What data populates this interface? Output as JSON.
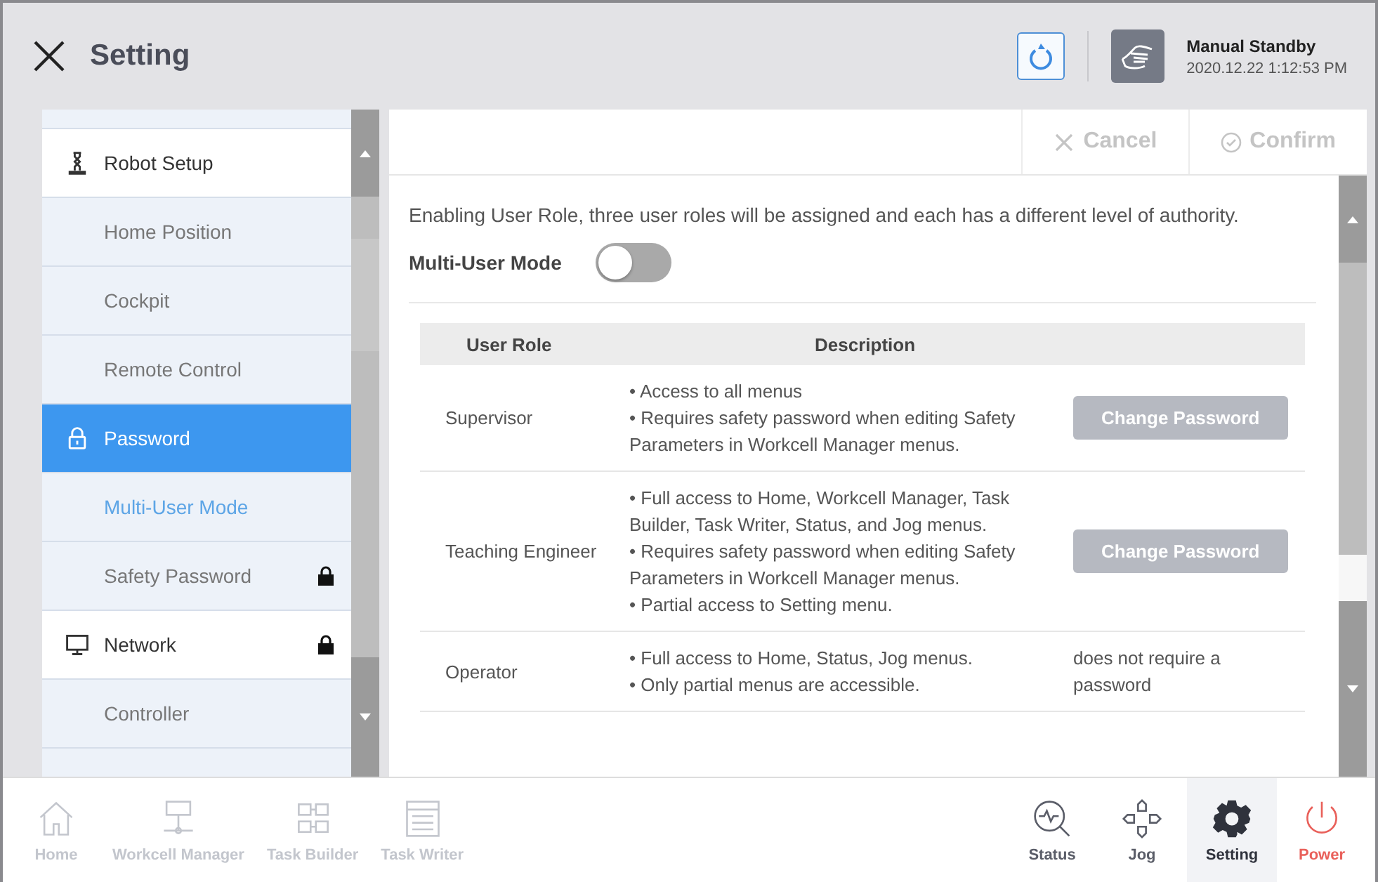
{
  "header": {
    "title": "Setting",
    "status": "Manual Standby",
    "datetime": "2020.12.22 1:12:53 PM"
  },
  "sidebar": {
    "items": [
      {
        "kind": "group",
        "label": "Robot Setup",
        "selected": false,
        "locked": false
      },
      {
        "kind": "item",
        "label": "Home Position",
        "selected": false,
        "locked": false
      },
      {
        "kind": "item",
        "label": "Cockpit",
        "selected": false,
        "locked": false
      },
      {
        "kind": "item",
        "label": "Remote Control",
        "selected": false,
        "locked": false
      },
      {
        "kind": "group",
        "label": "Password",
        "selected": true,
        "locked": false
      },
      {
        "kind": "item",
        "label": "Multi-User Mode",
        "selected": true,
        "locked": false
      },
      {
        "kind": "item",
        "label": "Safety Password",
        "selected": false,
        "locked": true
      },
      {
        "kind": "group",
        "label": "Network",
        "selected": false,
        "locked": true
      },
      {
        "kind": "item",
        "label": "Controller",
        "selected": false,
        "locked": false
      }
    ]
  },
  "actions": [
    {
      "kind": "cancel",
      "label": "Cancel",
      "disabled": true
    },
    {
      "kind": "confirm",
      "label": "Confirm",
      "disabled": true
    }
  ],
  "intro": "Enabling User Role, three user roles will be assigned and each has a different level of authority.",
  "multi_user_mode": {
    "label": "Multi-User Mode",
    "on": false
  },
  "table": {
    "columns": [
      "User Role",
      "Description"
    ],
    "rows": [
      {
        "role": "Supervisor",
        "description": [
          "• Access to all menus",
          "• Requires safety password when editing Safety Parameters in Workcell Manager menus."
        ],
        "action": {
          "kind": "button",
          "label": "Change Password",
          "disabled": true
        }
      },
      {
        "role": "Teaching Engineer",
        "description": [
          "• Full access to Home, Workcell Manager, Task Builder, Task Writer, Status, and Jog menus.",
          "• Requires safety password when editing Safety Parameters in Workcell Manager menus.",
          "• Partial access to Setting menu."
        ],
        "action": {
          "kind": "button",
          "label": "Change Password",
          "disabled": true
        }
      },
      {
        "role": "Operator",
        "description": [
          "• Full access to Home, Status, Jog menus.",
          "• Only partial menus are accessible."
        ],
        "action": {
          "kind": "note",
          "label": "does not require a password"
        }
      }
    ]
  },
  "nav": [
    {
      "kind": "home",
      "label": "Home",
      "disabled": true,
      "selected": false
    },
    {
      "kind": "workcell",
      "label": "Workcell Manager",
      "disabled": true,
      "selected": false
    },
    {
      "kind": "taskbuilder",
      "label": "Task Builder",
      "disabled": true,
      "selected": false
    },
    {
      "kind": "taskwriter",
      "label": "Task Writer",
      "disabled": true,
      "selected": false
    },
    {
      "kind": "spacer"
    },
    {
      "kind": "status",
      "label": "Status",
      "disabled": false,
      "selected": false
    },
    {
      "kind": "jog",
      "label": "Jog",
      "disabled": false,
      "selected": false
    },
    {
      "kind": "setting",
      "label": "Setting",
      "disabled": false,
      "selected": true
    },
    {
      "kind": "power",
      "label": "Power",
      "disabled": false,
      "selected": false
    }
  ]
}
